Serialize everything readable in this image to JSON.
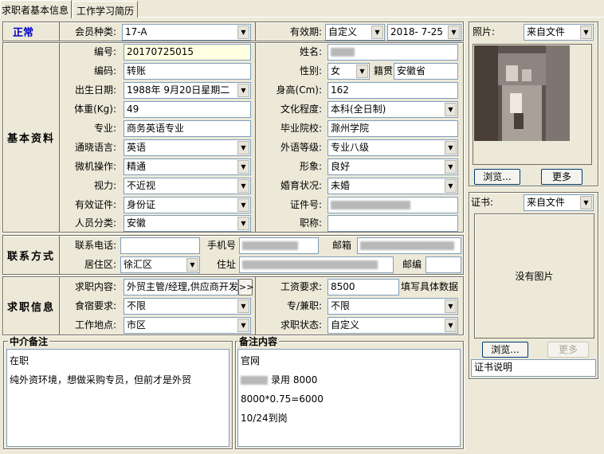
{
  "tabs": [
    "求职者基本信息",
    "工作学习简历"
  ],
  "sections": {
    "status": "正常",
    "basic": "基本资料",
    "contact": "联系方式",
    "job": "求职信息"
  },
  "top": {
    "member_type_label": "会员种类:",
    "member_type": "17-A",
    "validity_label": "有效期:",
    "validity_mode": "自定义",
    "validity_date": "2018- 7-25"
  },
  "basic": {
    "number_label": "编号:",
    "number": "20170725015",
    "name_label": "姓名:",
    "code_label": "编码:",
    "code": "转账",
    "gender_label": "性别:",
    "gender": "女",
    "native_label": "籍贯",
    "native": "安徽省",
    "birth_label": "出生日期:",
    "birth": "1988年 9月20日星期二",
    "height_label": "身高(Cm):",
    "height": "162",
    "weight_label": "体重(Kg):",
    "weight": "49",
    "edu_label": "文化程度:",
    "edu": "本科(全日制)",
    "major_label": "专业:",
    "major": "商务英语专业",
    "school_label": "毕业院校:",
    "school": "滁州学院",
    "lang_label": "通晓语言:",
    "lang": "英语",
    "foreign_label": "外语等级:",
    "foreign": "专业八级",
    "pc_label": "微机操作:",
    "pc": "精通",
    "image_label": "形象:",
    "image": "良好",
    "vision_label": "视力:",
    "vision": "不近视",
    "marriage_label": "婚育状况:",
    "marriage": "未婚",
    "id_type_label": "有效证件:",
    "id_type": "身份证",
    "id_no_label": "证件号:",
    "category_label": "人员分类:",
    "category": "安徽",
    "title_label": "职称:"
  },
  "contact": {
    "phone_label": "联系电话:",
    "mobile_label": "手机号",
    "email_label": "邮箱",
    "district_label": "居住区:",
    "district": "徐汇区",
    "address_label": "住址",
    "postcode_label": "邮编"
  },
  "job": {
    "content_label": "求职内容:",
    "content": "外贸主管/经理,供应商开发",
    "more_btn": ">>",
    "salary_label": "工资要求:",
    "salary": "8500",
    "salary_hint": "填写具体数据",
    "lodging_label": "食宿要求:",
    "lodging": "不限",
    "parttime_label": "专/兼职:",
    "parttime": "不限",
    "place_label": "工作地点:",
    "place": "市区",
    "status_label": "求职状态:",
    "status": "自定义"
  },
  "notes": {
    "agency_title": "中介备注",
    "agency_lines": [
      "在职",
      "纯外资环境，想做采购专员，但前才是外贸"
    ],
    "remark_title": "备注内容",
    "remark_lines": [
      "官网",
      "录用  8000",
      "8000*0.75=6000",
      "10/24到岗"
    ]
  },
  "photo": {
    "label": "照片:",
    "source": "来自文件",
    "browse_btn": "浏览...",
    "more_btn": "更多"
  },
  "cert": {
    "label": "证书:",
    "source": "来自文件",
    "no_image": "没有图片",
    "browse_btn": "浏览...",
    "more_btn": "更多",
    "desc": "证书说明"
  }
}
